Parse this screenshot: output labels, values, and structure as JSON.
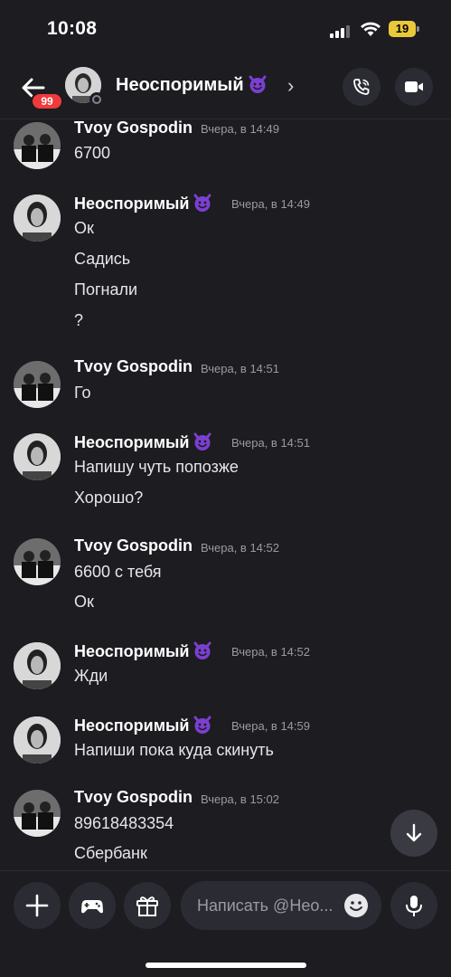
{
  "status_bar": {
    "time": "10:08",
    "battery": "19",
    "battery_color": "#e9c93a"
  },
  "header": {
    "title": "Неоспоримый",
    "unread_count": "99",
    "chevron": "›",
    "icons": [
      "back-arrow-icon",
      "phone-call-icon",
      "video-camera-icon"
    ]
  },
  "messages": [
    {
      "author": "Tvoy Gospodin",
      "time": "Вчера, в 14:49",
      "lines": [
        "6700"
      ]
    },
    {
      "author": "Неоспоримый",
      "time": "Вчера, в 14:49",
      "lines": [
        "Ок",
        "Садись",
        "Погнали",
        "?"
      ]
    },
    {
      "author": "Tvoy Gospodin",
      "time": "Вчера, в 14:51",
      "lines": [
        "Го"
      ]
    },
    {
      "author": "Неоспоримый",
      "time": "Вчера, в 14:51",
      "lines": [
        "Напишу чуть попозже",
        "Хорошо?"
      ]
    },
    {
      "author": "Tvoy Gospodin",
      "time": "Вчера, в 14:52",
      "lines": [
        "6600 с тебя",
        "Ок"
      ]
    },
    {
      "author": "Неоспоримый",
      "time": "Вчера, в 14:52",
      "lines": [
        "Жди"
      ]
    },
    {
      "author": "Неоспоримый",
      "time": "Вчера, в 14:59",
      "lines": [
        "Напиши пока куда скинуть"
      ]
    },
    {
      "author": "Tvoy Gospodin",
      "time": "Вчера, в 15:02",
      "lines": [
        "89618483354",
        "Сбербанк"
      ]
    }
  ],
  "composer": {
    "placeholder": "Написать @Нео..."
  },
  "colors": {
    "background": "#1c1c21",
    "badge": "#ef3b3b",
    "devil_emoji": "#7b3fd1",
    "button": "#2b2c33"
  }
}
